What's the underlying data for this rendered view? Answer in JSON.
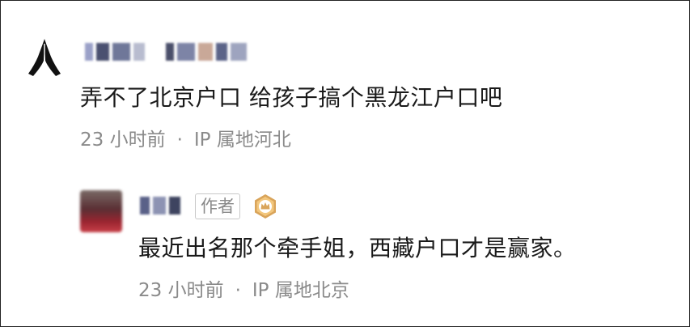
{
  "comment": {
    "avatar_icon": "folded-hands-icon",
    "username": "",
    "text": "弄不了北京户口 给孩子搞个黑龙江户口吧",
    "time": "23 小时前",
    "separator": "·",
    "location": "IP 属地河北"
  },
  "reply": {
    "username": "",
    "author_tag": "作者",
    "badge_icon": "crown-badge-icon",
    "text": "最近出名那个牵手姐，西藏户口才是赢家。",
    "time": "23 小时前",
    "separator": "·",
    "location": "IP 属地北京"
  },
  "colors": {
    "text": "#1a1a1a",
    "meta": "#8a8a8a",
    "badge": "#d9a45a"
  }
}
